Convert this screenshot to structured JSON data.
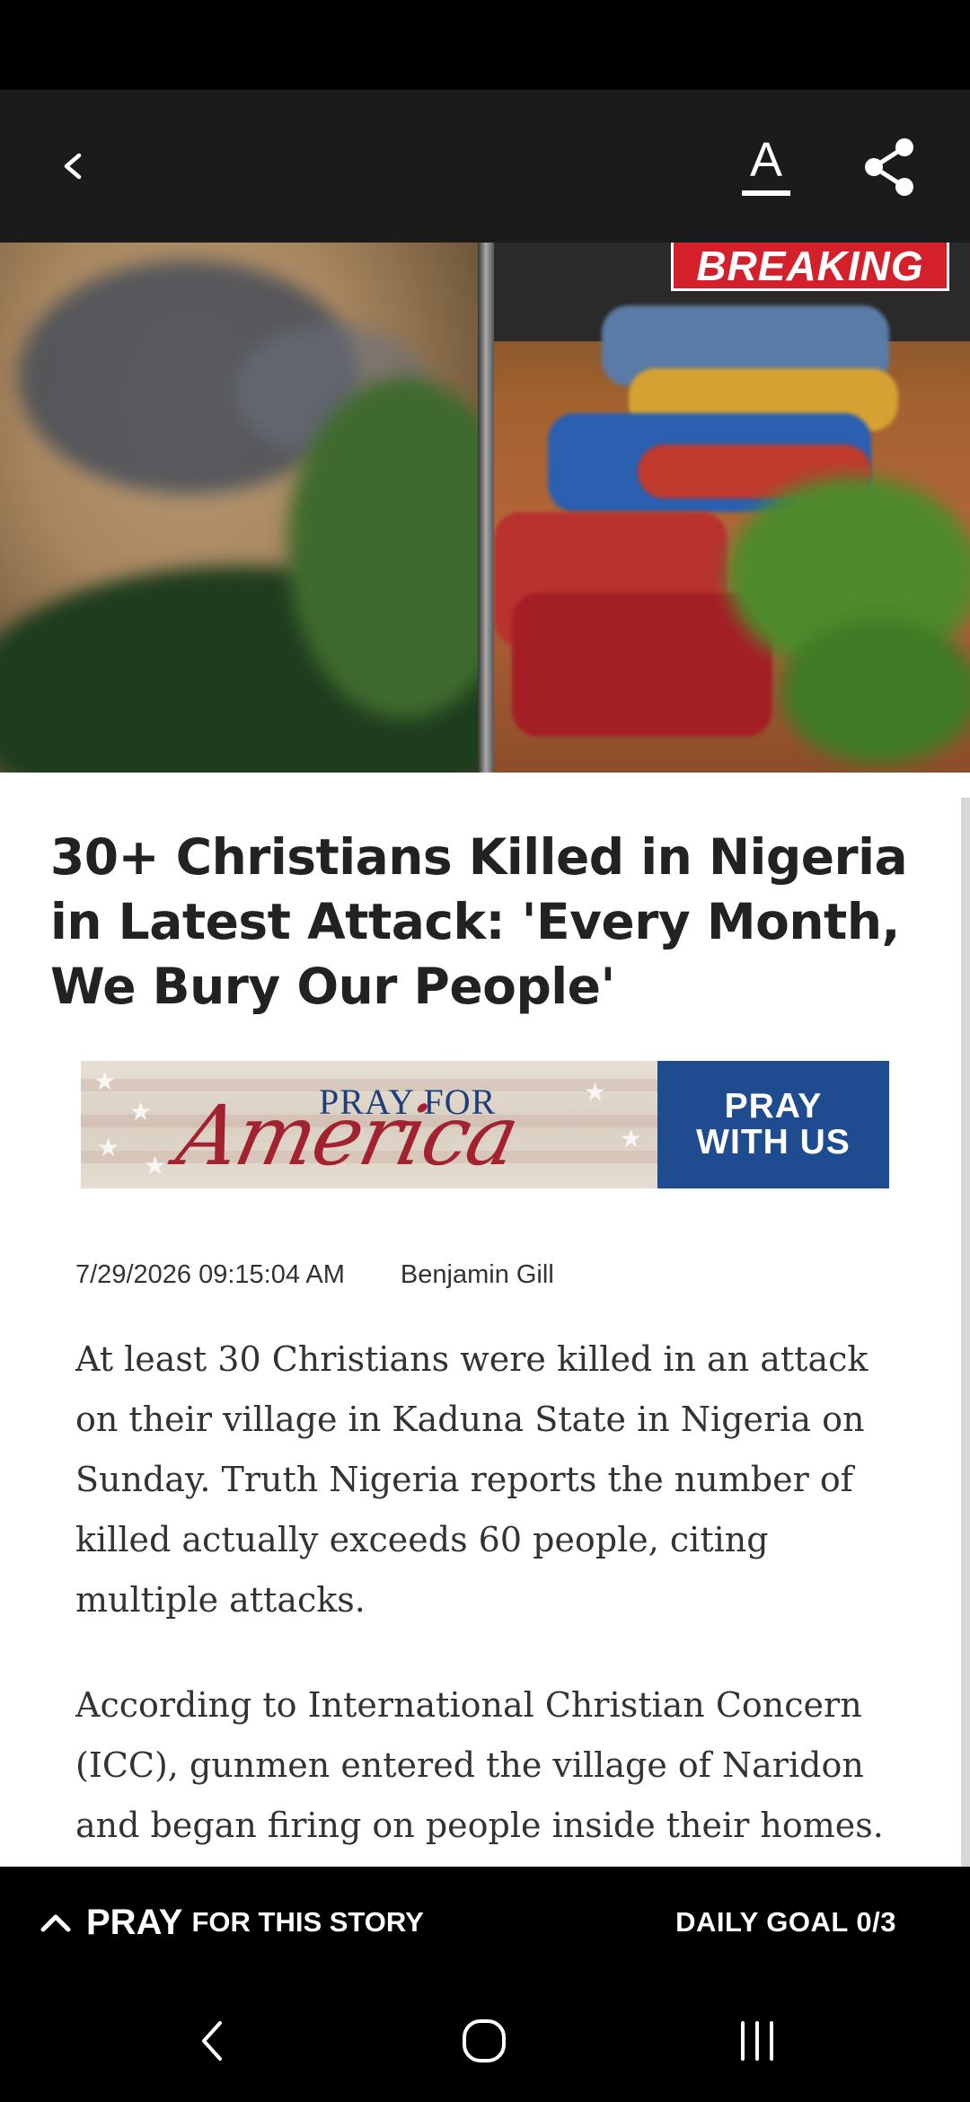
{
  "header": {
    "back_icon": "chevron-left-icon",
    "font_size_label": "A",
    "share_icon": "share-icon"
  },
  "hero": {
    "badge": "BREAKING"
  },
  "article": {
    "title": "30+ Christians Killed in Nigeria in Latest Attack: 'Every Month, We Bury Our People'",
    "date": "7/29/2026 09:15:04 AM",
    "author": "Benjamin Gill",
    "paragraphs": [
      "At least 30 Christians were killed in an attack on their village in Kaduna State in Nigeria on Sunday. Truth Nigeria reports the number of killed actually exceeds 60 people, citing multiple attacks.",
      "According to International Christian Concern (ICC), gunmen entered the village of Naridon and began firing on people inside their homes."
    ]
  },
  "banner": {
    "pray_for": "PRAY FOR",
    "america": "America",
    "cta": "PRAY WITH US"
  },
  "pray_bar": {
    "pray": "PRAY",
    "for_this_story": "FOR THIS STORY",
    "daily_goal": "DAILY GOAL 0/3"
  },
  "colors": {
    "app_bar": "#1b1b1b",
    "breaking": "#d3202a",
    "banner_blue": "#1f4c91",
    "america_red": "#a32230"
  }
}
